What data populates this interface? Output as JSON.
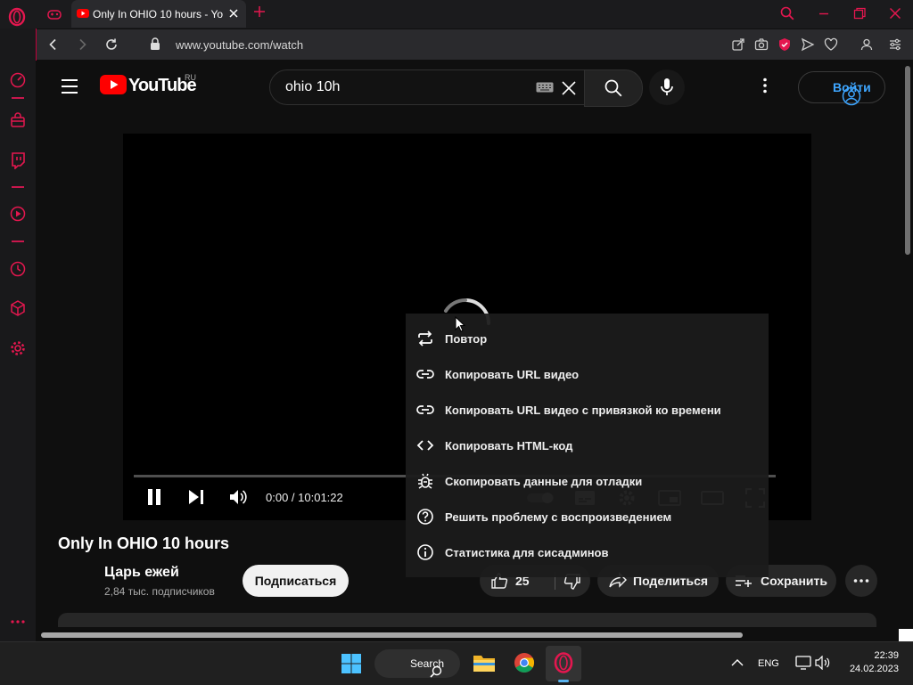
{
  "browser": {
    "tab_title": "Only In OHIO 10 hours - YouTube",
    "url": "www.youtube.com/watch",
    "accent_color": "#e4174f"
  },
  "youtube": {
    "logo_text": "YouTube",
    "region": "RU",
    "search_query": "ohio 10h",
    "signin_label": "Войти"
  },
  "player": {
    "time_display": "0:00 / 10:01:22",
    "progress": 0,
    "state": "loading"
  },
  "context_menu": [
    {
      "icon": "repeat-icon",
      "label": "Повтор"
    },
    {
      "icon": "link-icon",
      "label": "Копировать URL видео"
    },
    {
      "icon": "link-icon",
      "label": "Копировать URL видео с привязкой ко времени"
    },
    {
      "icon": "code-icon",
      "label": "Копировать HTML-код"
    },
    {
      "icon": "bug-icon",
      "label": "Скопировать данные для отладки"
    },
    {
      "icon": "help-icon",
      "label": "Решить проблему с воспроизведением"
    },
    {
      "icon": "info-icon",
      "label": "Статистика для сисадминов"
    }
  ],
  "video": {
    "title": "Only In OHIO 10 hours",
    "channel": "Царь ежей",
    "subscribers": "2,84 тыс. подписчиков",
    "subscribe_label": "Подписаться",
    "likes": "25",
    "share_label": "Поделиться",
    "save_label": "Сохранить"
  },
  "taskbar": {
    "search_label": "Search",
    "language": "ENG",
    "time": "22:39",
    "date": "24.02.2023"
  }
}
